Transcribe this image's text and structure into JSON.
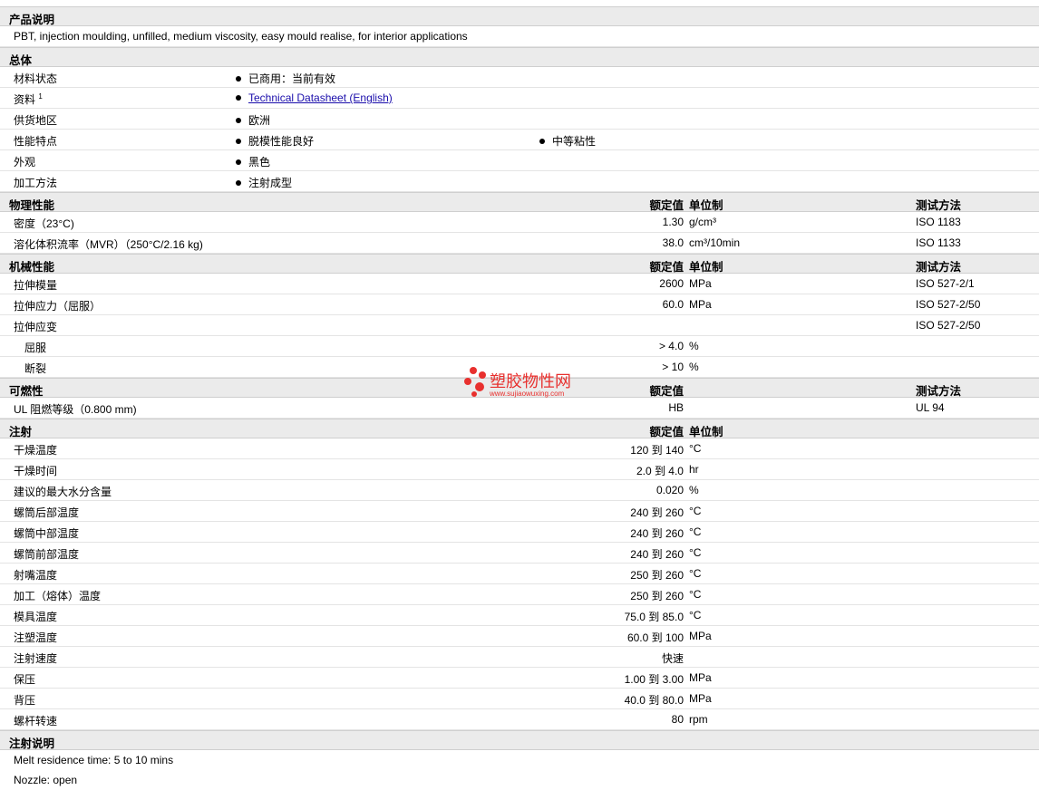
{
  "headers": {
    "value": "额定值",
    "unit": "单位制",
    "test": "测试方法"
  },
  "description": {
    "title": "产品说明",
    "text": "PBT, injection moulding, unfilled, medium viscosity, easy mould realise, for interior applications"
  },
  "general": {
    "title": "总体",
    "rows": [
      {
        "label": "材料状态",
        "b1": "已商用：当前有效"
      },
      {
        "label": "资料",
        "sup": "1",
        "link": "Technical Datasheet (English)"
      },
      {
        "label": "供货地区",
        "b1": "欧洲"
      },
      {
        "label": "性能特点",
        "b1": "脱模性能良好",
        "b2": "中等粘性"
      },
      {
        "label": "外观",
        "b1": "黑色"
      },
      {
        "label": "加工方法",
        "b1": "注射成型"
      }
    ]
  },
  "physical": {
    "title": "物理性能",
    "rows": [
      {
        "label": "密度（23°C)",
        "value": "1.30",
        "unit": "g/cm³",
        "test": "ISO 1183"
      },
      {
        "label": "溶化体积流率（MVR）（250°C/2.16 kg)",
        "value": "38.0",
        "unit": "cm³/10min",
        "test": "ISO 1133"
      }
    ]
  },
  "mechanical": {
    "title": "机械性能",
    "rows": [
      {
        "label": "拉伸模量",
        "value": "2600",
        "unit": "MPa",
        "test": "ISO 527-2/1"
      },
      {
        "label": "拉伸应力（屈服）",
        "value": "60.0",
        "unit": "MPa",
        "test": "ISO 527-2/50"
      },
      {
        "label": "拉伸应变",
        "value": "",
        "unit": "",
        "test": "ISO 527-2/50"
      },
      {
        "label": "屈服",
        "sub": true,
        "value": "> 4.0",
        "unit": "%",
        "test": ""
      },
      {
        "label": "断裂",
        "sub": true,
        "value": "> 10",
        "unit": "%",
        "test": ""
      }
    ]
  },
  "flammability": {
    "title": "可燃性",
    "rows": [
      {
        "label": "UL 阻燃等级（0.800 mm)",
        "value": "HB",
        "unit": "",
        "test": "UL 94"
      }
    ]
  },
  "injection": {
    "title": "注射",
    "rows": [
      {
        "label": "干燥温度",
        "value": "120 到  140",
        "unit": "°C"
      },
      {
        "label": "干燥时间",
        "value": "2.0 到  4.0",
        "unit": "hr"
      },
      {
        "label": "建议的最大水分含量",
        "value": "0.020",
        "unit": "%"
      },
      {
        "label": "螺筒后部温度",
        "value": "240 到  260",
        "unit": "°C"
      },
      {
        "label": "螺筒中部温度",
        "value": "240 到  260",
        "unit": "°C"
      },
      {
        "label": "螺筒前部温度",
        "value": "240 到  260",
        "unit": "°C"
      },
      {
        "label": "射嘴温度",
        "value": "250 到  260",
        "unit": "°C"
      },
      {
        "label": "加工（熔体）温度",
        "value": "250 到  260",
        "unit": "°C"
      },
      {
        "label": "模具温度",
        "value": "75.0 到  85.0",
        "unit": "°C"
      },
      {
        "label": "注塑温度",
        "value": "60.0 到  100",
        "unit": "MPa"
      },
      {
        "label": "注射速度",
        "value": "快速",
        "unit": ""
      },
      {
        "label": "保压",
        "value": "1.00 到  3.00",
        "unit": "MPa"
      },
      {
        "label": "背压",
        "value": "40.0 到  80.0",
        "unit": "MPa"
      },
      {
        "label": "螺杆转速",
        "value": "80",
        "unit": "rpm"
      }
    ]
  },
  "notes": {
    "title": "注射说明",
    "lines": [
      "Melt residence time: 5 to 10 mins",
      "Nozzle: open"
    ]
  },
  "watermark": {
    "text": "塑胶物性网",
    "url": "www.sujiaowuxing.com",
    "color": "#e8302e"
  }
}
